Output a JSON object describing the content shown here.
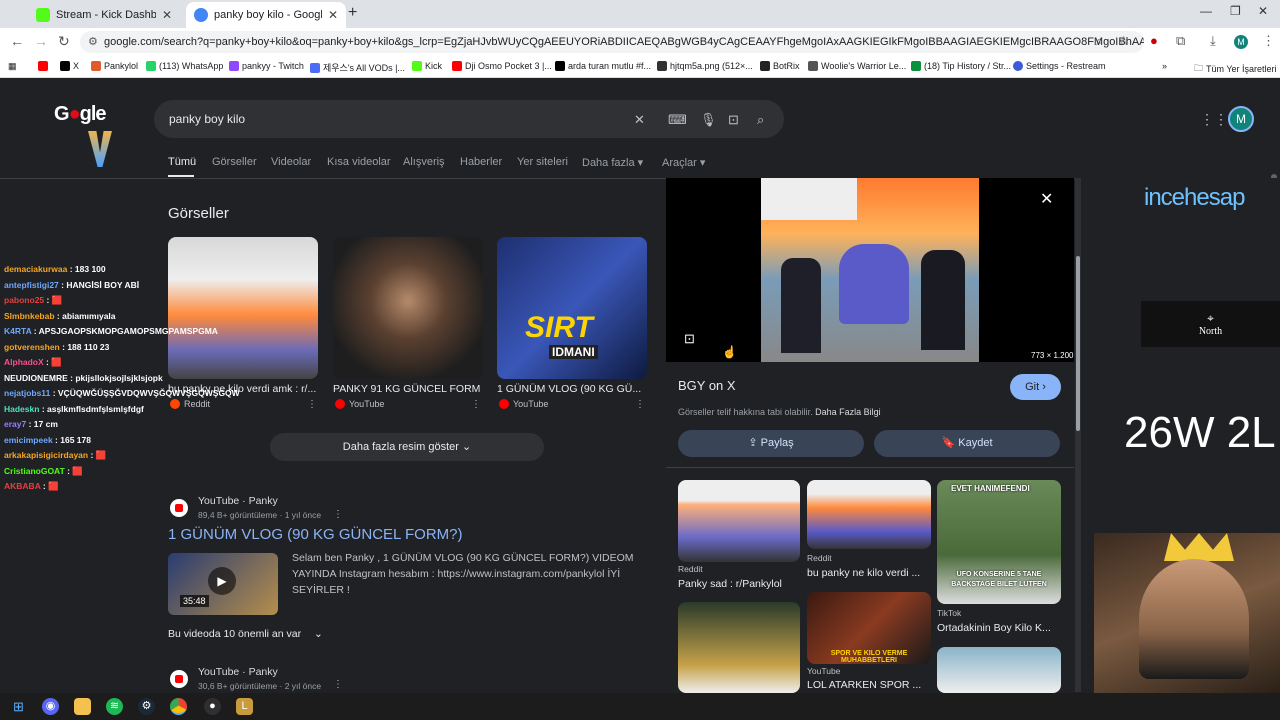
{
  "browser": {
    "tabs": [
      {
        "title": "Stream - Kick Dashboard",
        "favicon_color": "#53fc18"
      },
      {
        "title": "panky boy kilo - Google'da Ara",
        "favicon_color": "#4285f4"
      }
    ],
    "url": "google.com/search?q=panky+boy+kilo&oq=panky+boy+kilo&gs_lcrp=EgZjaHJvbWUyCQgAEEUYORiABDIICAEQABgWGB4yCAgCEAAYFhgeMgoIAxAAGKIEGIkFMgoIBBAAGIAEGKIEMgcIBRAAGO8FMgoIBhAAGKIEGIkF0gEIMTY5M2owajeo...",
    "bookmarks": [
      {
        "label": "",
        "color": "#ff0000"
      },
      {
        "label": "X",
        "color": "#000000"
      },
      {
        "label": "Pankylol",
        "color": "#e05a2b"
      },
      {
        "label": "(113) WhatsApp",
        "color": "#25d366"
      },
      {
        "label": "pankyy - Twitch",
        "color": "#9146ff"
      },
      {
        "label": "제우스's All VODs |...",
        "color": "#4a6cf7"
      },
      {
        "label": "Kick",
        "color": "#53fc18"
      },
      {
        "label": "Dji Osmo Pocket 3 |...",
        "color": "#ff0000"
      },
      {
        "label": "arda turan mutlu #f...",
        "color": "#000000"
      },
      {
        "label": "hjtqm5a.png (512×...",
        "color": "#333333"
      },
      {
        "label": "BotRix",
        "color": "#222222"
      },
      {
        "label": "Woolie's Warrior Le...",
        "color": "#555555"
      },
      {
        "label": "(18) Tip History / Str...",
        "color": "#0a8f3a"
      },
      {
        "label": "Settings - Restream",
        "color": "#3b5bdb"
      }
    ],
    "other_bookmarks": "Tüm Yer İşaretleri"
  },
  "google": {
    "query": "panky boy kilo",
    "avatar_letter": "M",
    "nav": [
      "Tümü",
      "Görseller",
      "Videolar",
      "Kısa videolar",
      "Alışveriş",
      "Haberler",
      "Yer siteleri",
      "Daha fazla ▾",
      "Araçlar ▾"
    ],
    "images_heading": "Görseller",
    "images": [
      {
        "caption": "bu panky ne kilo verdi amk : r/...",
        "source": "Reddit",
        "source_color": "#ff4500"
      },
      {
        "caption": "PANKY 91 KG GÜNCEL FORM",
        "source": "YouTube",
        "source_color": "#ff0000"
      },
      {
        "caption": "1 GÜNÜM VLOG (90 KG GÜ...",
        "source": "YouTube",
        "source_color": "#ff0000"
      }
    ],
    "more_images": "Daha fazla resim göster",
    "results": [
      {
        "source": "YouTube · Panky",
        "meta": "89,4 B+ görüntüleme · 1 yıl önce",
        "title": "1 GÜNÜM VLOG (90 KG GÜNCEL FORM?)",
        "duration": "35:48",
        "snippet": "Selam ben Panky , 1 GÜNÜM VLOG (90 KG GÜNCEL FORM?) VIDEOM YAYINDA Instagram hesabım : https://www.instagram.com/pankylol İYİ SEYİRLER !",
        "key_moments": "Bu videoda 10 önemli an var"
      },
      {
        "source": "YouTube · Panky",
        "meta": "30,6 B+ görüntüleme · 2 yıl önce"
      }
    ],
    "panel": {
      "dimensions": "773 × 1.200",
      "title": "BGY on X",
      "visit": "Git ›",
      "note": "Görseller telif hakkına tabi olabilir.",
      "note_link": "Daha Fazla Bilgi",
      "share": "Paylaş",
      "save": "Kaydet",
      "related": [
        {
          "caption": "Panky sad : r/Pankylol",
          "source": "Reddit"
        },
        {
          "caption": "bu panky ne kilo verdi ...",
          "source": "Reddit"
        },
        {
          "caption": "Ortadakinin Boy Kilo K...",
          "source": "TikTok",
          "overlay_top": "EVET HANIMEFENDI",
          "overlay_bottom": "UFO KONSERINE 5 TANE BACKSTAGE BILET LUTFEN"
        },
        {
          "caption": "",
          "source": ""
        },
        {
          "caption": "LOL ATARKEN SPOR ...",
          "source": "YouTube",
          "overlay": "SPOR VE KILO VERME MUHABBETLERI"
        },
        {
          "caption": "",
          "source": ""
        }
      ]
    }
  },
  "image_overlays": {
    "sirt": "SIRT",
    "idmani": "IDMANI"
  },
  "stream_overlay": {
    "chat": [
      {
        "user": "demaciakurwaa",
        "msg": ": 183 100",
        "color": "#f5a623"
      },
      {
        "user": "antepfistigi27",
        "msg": ": HANGİSİ BOY ABİ",
        "color": "#6fa8ff"
      },
      {
        "user": "pabono25",
        "msg": ": 🟥",
        "color": "#e83e3e"
      },
      {
        "user": "Slmbnkebab",
        "msg": ": abiamımıyala",
        "color": "#f5a623"
      },
      {
        "user": "K4RTA",
        "msg": ": APSJGAOPSKMOPGAMOPSMGPAMSPGMA",
        "color": "#6fa8ff"
      },
      {
        "user": "gotverenshen",
        "msg": ": 188 110 23",
        "color": "#f5a623"
      },
      {
        "user": "AlphadoX",
        "msg": ": 🟥",
        "color": "#ff4d8d"
      },
      {
        "user": "NEUDIONEMRE",
        "msg": ": pkijsllokjsojlsjklsjopk",
        "color": "#ffffff"
      },
      {
        "user": "nejatjobs11",
        "msg": ": VÇÜQWĞÜŞŞĞVDQWVŞĞQWVŞGQWŞGQW",
        "color": "#6fa8ff"
      },
      {
        "user": "Hadeskn",
        "msg": ": asşlkmflsdmfşlsmlşfdgf",
        "color": "#4ee0c0"
      },
      {
        "user": "eray7",
        "msg": ": 17 cm",
        "color": "#9b7bff"
      },
      {
        "user": "emicimpeek",
        "msg": ": 165 178",
        "color": "#6fa8ff"
      },
      {
        "user": "arkakapisigicirdayan",
        "msg": ": 🟥",
        "color": "#f5a623"
      },
      {
        "user": "CristianoGOAT",
        "msg": ": 🟥",
        "color": "#53fc18"
      },
      {
        "user": "AKBABA",
        "msg": ": 🟥",
        "color": "#e83e3e"
      }
    ],
    "sponsor": "incehesap",
    "north": "North",
    "score": "26W 2L"
  },
  "taskbar": [
    "start",
    "discord",
    "explorer",
    "spotify",
    "steam",
    "chrome",
    "obs",
    "league"
  ]
}
